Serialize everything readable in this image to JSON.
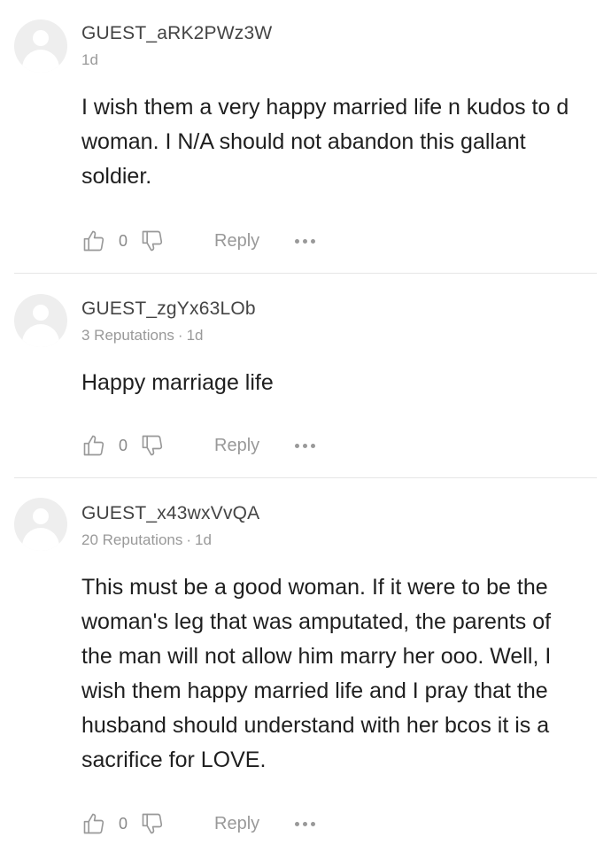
{
  "comments": [
    {
      "username": "GUEST_aRK2PWz3W",
      "reputation": "",
      "time": "1d",
      "text": "I wish them a very happy married life n kudos to d woman. I N/A should not abandon this gallant soldier.",
      "likes": "0",
      "reply_label": "Reply"
    },
    {
      "username": "GUEST_zgYx63LOb",
      "reputation": "3 Reputations",
      "time": "1d",
      "text": "Happy marriage life",
      "likes": "0",
      "reply_label": "Reply"
    },
    {
      "username": "GUEST_x43wxVvQA",
      "reputation": "20 Reputations",
      "time": "1d",
      "text": "This must be a good woman. If it were to be the woman's leg that was amputated, the parents of the man will not allow him marry her ooo. Well, I wish them happy married life and I pray that the husband should understand with her bcos it is a sacrifice for LOVE.",
      "likes": "0",
      "reply_label": "Reply"
    }
  ],
  "icons": {
    "like": "thumbs-up-icon",
    "dislike": "thumbs-down-icon",
    "more": "more-options-icon",
    "avatar": "default-avatar-icon"
  },
  "colors": {
    "username": "#444444",
    "meta": "#999999",
    "text": "#1f1f1f",
    "divider": "#e6e6e6",
    "avatar_bg": "#eeeeee"
  }
}
